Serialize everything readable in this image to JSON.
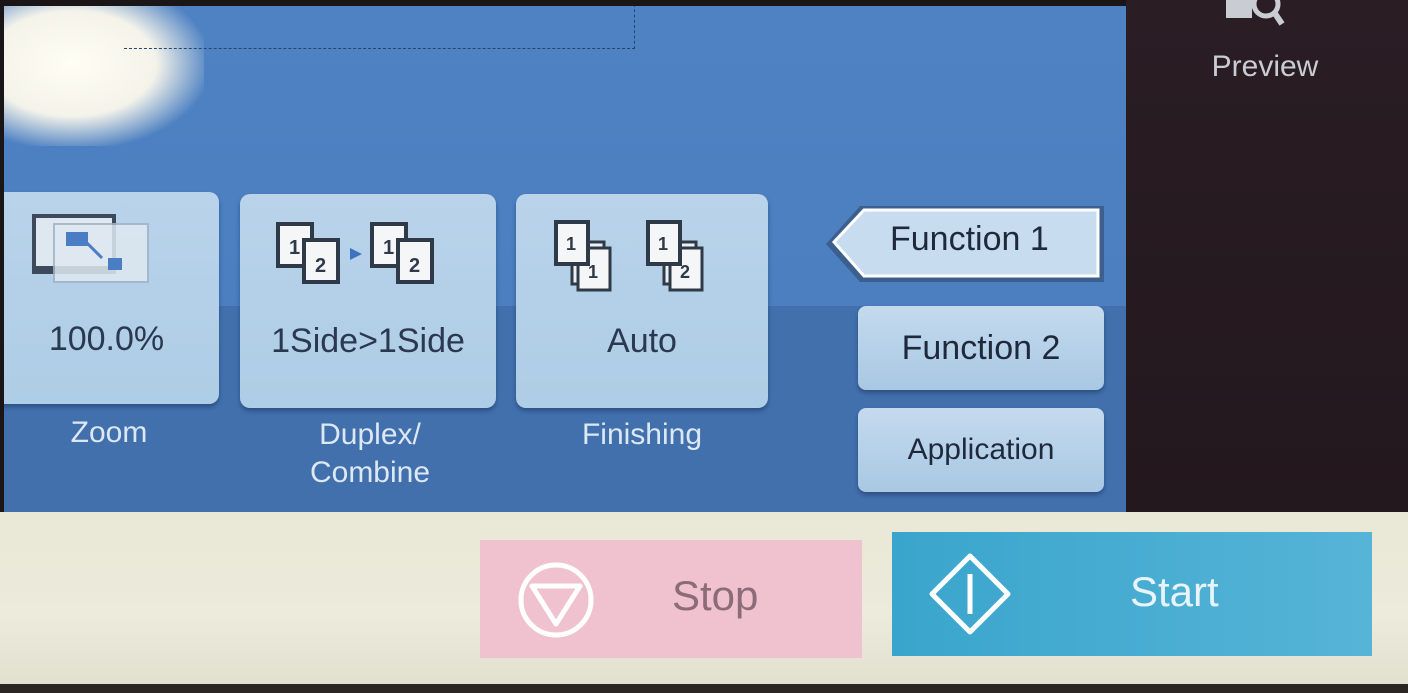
{
  "preview": {
    "label": "Preview",
    "icon": "magnifier-preview-icon"
  },
  "tiles": [
    {
      "id": "zoom",
      "value": "100.0%",
      "caption": "Zoom",
      "icon": "zoom-scale-icon"
    },
    {
      "id": "duplex",
      "value": "1Side>1Side",
      "caption_line1": "Duplex/",
      "caption_line2": "Combine",
      "icon": "duplex-pages-icon"
    },
    {
      "id": "finishing",
      "value": "Auto",
      "caption": "Finishing",
      "icon": "finishing-stack-icon"
    }
  ],
  "functions": [
    {
      "label": "Function 1",
      "selected": true
    },
    {
      "label": "Function 2",
      "selected": false
    },
    {
      "label": "Application",
      "selected": false
    }
  ],
  "hardware": {
    "stop_label": "Stop",
    "start_label": "Start"
  },
  "colors": {
    "screen_blue": "#4b7fc0",
    "tile": "#b3d0e8",
    "stop": "#f0c2cf",
    "start": "#3aa5cc"
  }
}
